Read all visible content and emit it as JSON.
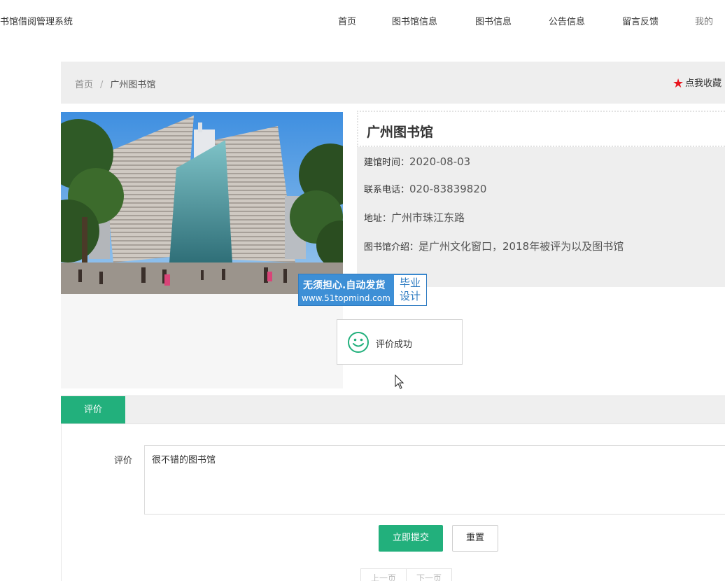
{
  "header": {
    "brand": "书馆借阅管理系统",
    "nav": [
      "首页",
      "图书馆信息",
      "图书信息",
      "公告信息",
      "留言反馈",
      "我的"
    ]
  },
  "breadcrumb": {
    "home": "首页",
    "separator": "/",
    "current": "广州图书馆",
    "favorite_label": "点我收藏"
  },
  "library": {
    "title": "广州图书馆",
    "fields": [
      {
        "label": "建馆时间：",
        "value": "2020-08-03"
      },
      {
        "label": "联系电话：",
        "value": "020-83839820"
      },
      {
        "label": "地址：",
        "value": "广州市珠江东路"
      },
      {
        "label": "图书馆介绍：",
        "value": "是广州文化窗口，2018年被评为以及图书馆"
      }
    ]
  },
  "watermark": {
    "line1": "无须担心.自动发货",
    "line2": "www.51topmind.com",
    "box_line1": "毕业",
    "box_line2": "设计"
  },
  "toast": {
    "message": "评价成功"
  },
  "tabs": {
    "active": "评价"
  },
  "form": {
    "label": "评价",
    "value": "很不错的图书馆",
    "submit": "立即提交",
    "reset": "重置"
  },
  "pager": {
    "prev": "上一页",
    "next": "下一页"
  },
  "colors": {
    "accent": "#22b07c",
    "star": "#e8141d",
    "watermark": "#3d8fd6"
  }
}
